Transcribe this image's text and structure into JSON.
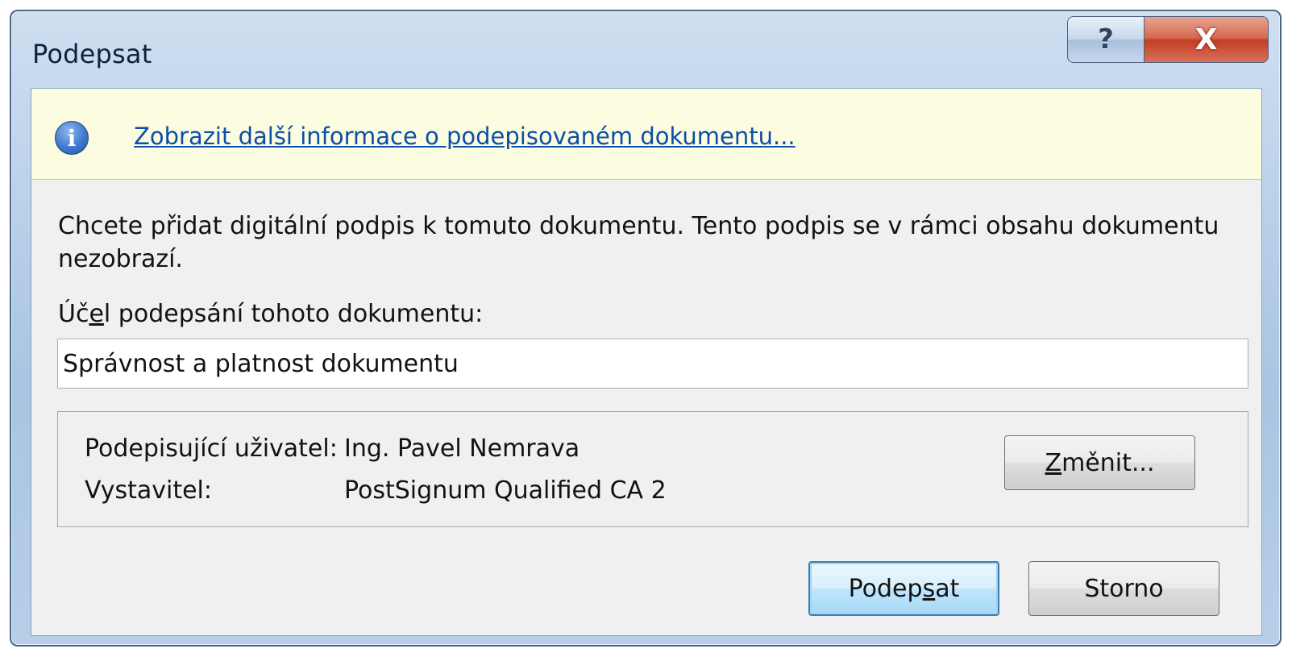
{
  "window": {
    "title": "Podepsat",
    "help_glyph": "?",
    "close_glyph": "X"
  },
  "infobar": {
    "icon": "info-icon",
    "icon_glyph": "i",
    "link_text": "Zobrazit další informace o podepisovaném dokumentu..."
  },
  "description": "Chcete přidat digitální podpis k tomuto dokumentu. Tento podpis se v rámci obsahu dokumentu nezobrazí.",
  "purpose": {
    "label_before": "Úč",
    "label_accel": "e",
    "label_after": "l podepsání tohoto dokumentu:",
    "value": "Správnost a platnost dokumentu"
  },
  "signer": {
    "user_label": "Podepisující uživatel:",
    "user_value": "Ing. Pavel Nemrava",
    "issuer_label": "Vystavitel:",
    "issuer_value": "PostSignum Qualified CA 2",
    "change_accel": "Z",
    "change_rest": "měnit..."
  },
  "buttons": {
    "sign_before": "Podep",
    "sign_accel": "s",
    "sign_after": "at",
    "cancel": "Storno"
  },
  "colors": {
    "link": "#0b4fa8",
    "infobar_bg": "#fcfce0",
    "dialog_bg": "#f0f0f0",
    "close_button": "#c23f24"
  }
}
